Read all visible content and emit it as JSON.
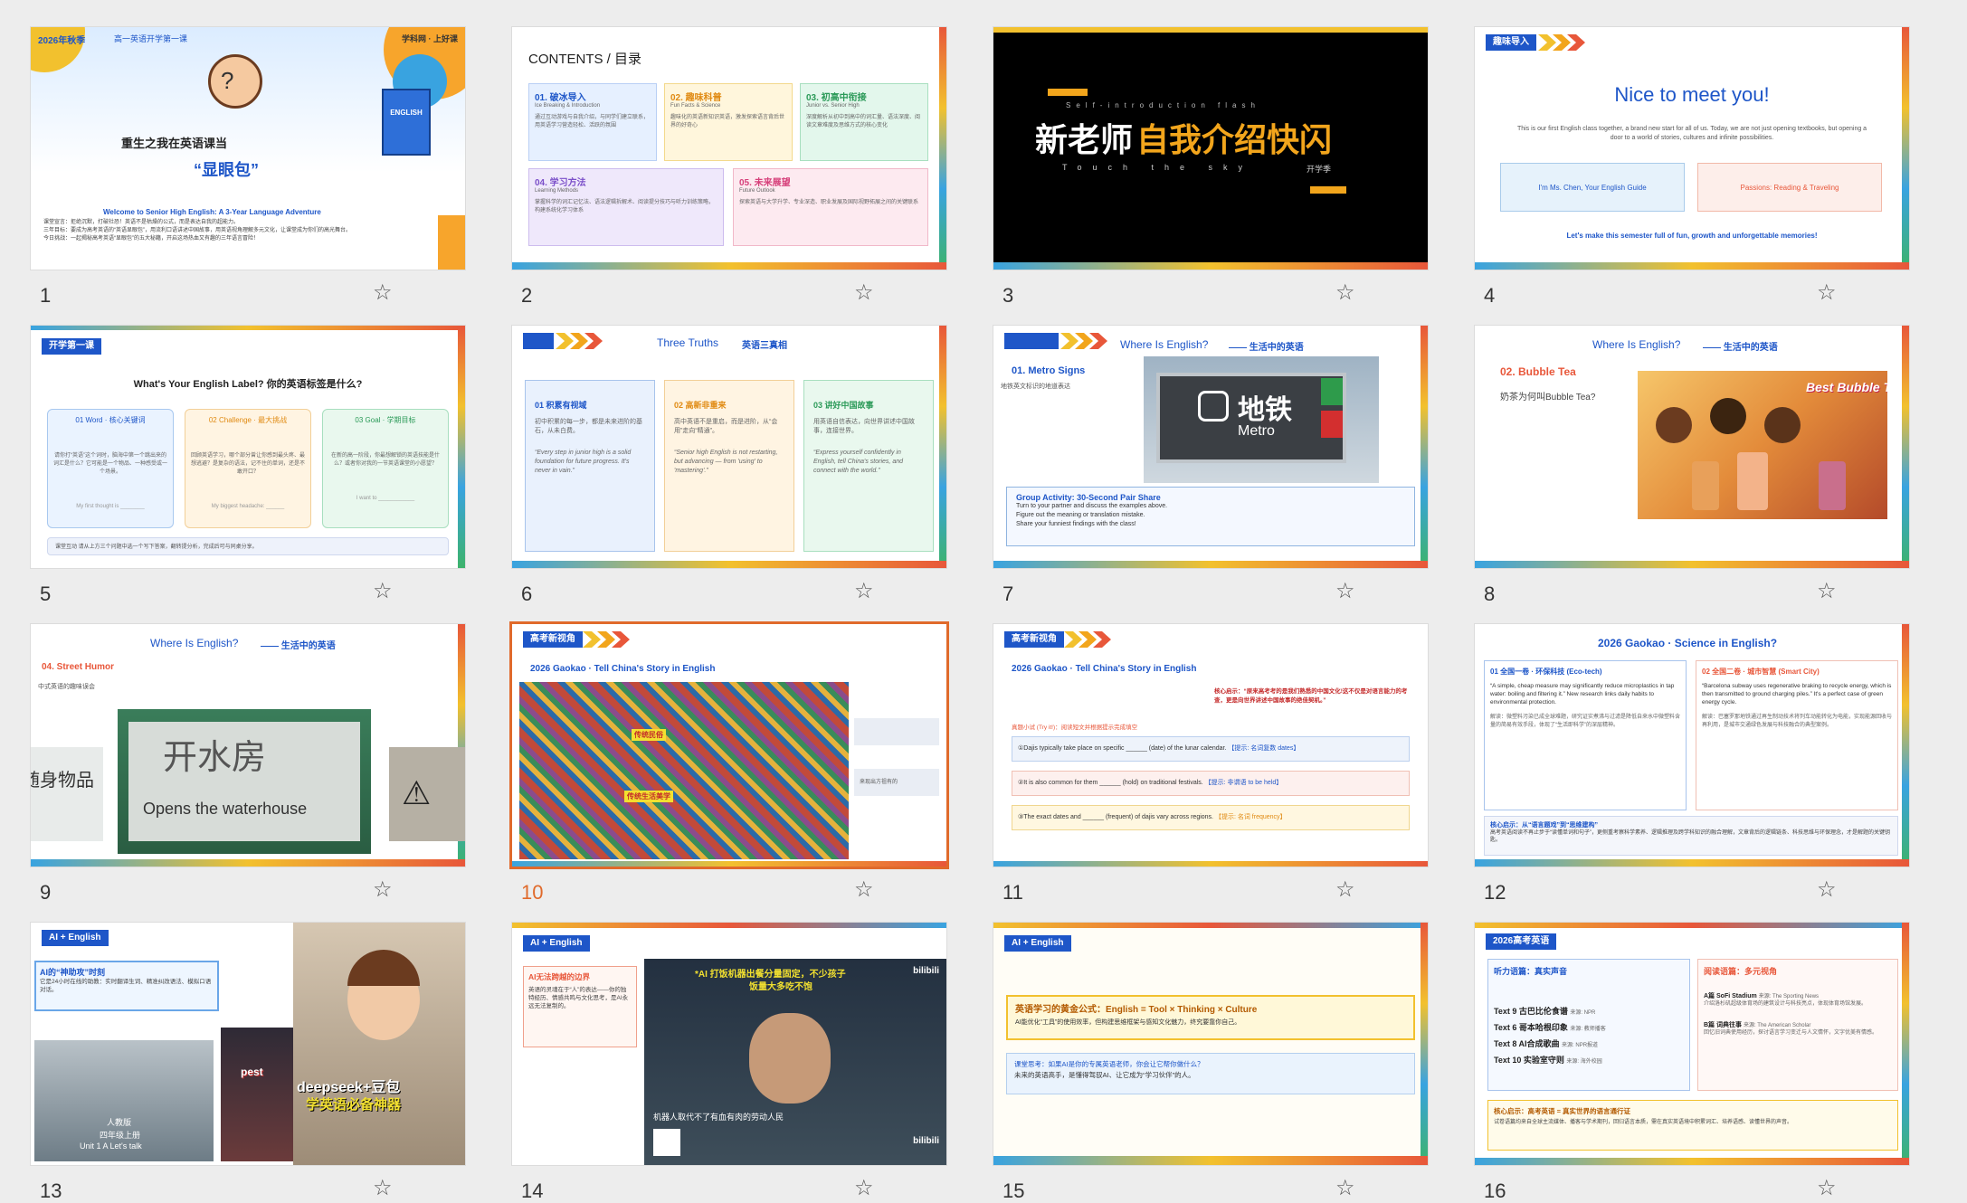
{
  "colors": {
    "accent": "#e06a2b",
    "blue": "#1e56c8",
    "yellow": "#f2c12e",
    "red": "#e8573a",
    "green": "#3db36b"
  },
  "slides": [
    {
      "num": "1",
      "tag": "2026年秋季",
      "subtag": "高一英语开学第一课",
      "brand": "学科网 · 上好课",
      "title_a": "重生之我在英语课当",
      "title_b": "“显眼包”",
      "book": "ENGLISH",
      "welcome": "Welcome to Senior High English: A 3-Year Language Adventure",
      "lines": [
        "课堂宣言：拒绝沉默，打破社恐！英语不是枯燥的公式，而是表达自我的超能力。",
        "三年目标：要成为高考英语的“英语显眼包”，用流利口语讲述中国故事，用英语视角理解多元文化，让课堂成为你们的高光舞台。",
        "今日挑战：一起揭秘高考英语“显眼包”的五大秘籍，开启这场热血又有趣的三年语言冒险！"
      ]
    },
    {
      "num": "2",
      "title": "CONTENTS / 目录",
      "cards": [
        {
          "h": "01. 破冰导入",
          "s": "Ice Breaking & Introduction",
          "d": "通过互动游戏与自我介绍，与同学们建立联系，用英语学习营造轻松、活跃的氛围"
        },
        {
          "h": "02. 趣味科普",
          "s": "Fun Facts & Science",
          "d": "趣味化的英语新知识英语，激发探索语言背后世界的好奇心"
        },
        {
          "h": "03. 初高中衔接",
          "s": "Junior vs. Senior High",
          "d": "深度解析从初中到高中的词汇量、语法深度、阅读文章难度及思维方式的核心变化"
        },
        {
          "h": "04. 学习方法",
          "s": "Learning Methods",
          "d": "掌握科学的词汇记忆法、语法逻辑拆解术、阅读提分技巧与听力训练策略，构建系统化学习体系"
        },
        {
          "h": "05. 未来展望",
          "s": "Future Outlook",
          "d": "探索英语与大学升学、专业深造、职业发展及国际视野拓展之间的关键联系"
        }
      ]
    },
    {
      "num": "3",
      "top": "Self-introduction flash",
      "main_a": "新老师",
      "main_b": "自我介绍快闪",
      "sub": "Touch the sky",
      "sub2": "开学季"
    },
    {
      "num": "4",
      "tag": "趣味导入",
      "title": "Nice to meet you!",
      "body": "This is our first English class together, a brand new start for all of us. Today, we are not just opening textbooks, but opening a door to a world of stories, cultures and infinite possibilities.",
      "btn1": "I'm Ms. Chen, Your English Guide",
      "btn2": "Passions: Reading & Traveling",
      "foot": "Let's make this semester full of fun, growth and unforgettable memories!"
    },
    {
      "num": "5",
      "tag": "开学第一课",
      "title": "What's Your English Label? 你的英语标签是什么?",
      "cards": [
        {
          "h": "01 Word · 核心关键词",
          "d": "请你打“英语”这个词时，脑海中第一个跳出来的词汇是什么？它可能是一个物品、一种感受或一个场景。",
          "f": "My first thought is ________"
        },
        {
          "h": "02 Challenge · 最大挑战",
          "d": "回顾英语学习，哪个部分曾让你感到最头疼、最想逃避？是复杂的语法，记不住的单词，还是不敢开口？",
          "f": "My biggest headache: ______"
        },
        {
          "h": "03 Goal · 学期目标",
          "d": "在新的高一阶段，你最想解锁的英语技能是什么？或者你对我的一节英语课堂的小愿望？",
          "f": "I want to ____________"
        }
      ],
      "foot": "课堂互动 请从上方三个问题中选一个写下答案，翻转提分析，完成后可与同桌分享。"
    },
    {
      "num": "6",
      "title": "Three Truths",
      "title_cn": "英语三真相",
      "cols": [
        {
          "h": "01 积累有视域",
          "d": "初中积累的每一步，都是未来进阶的基石，从未白费。",
          "q": "“Every step in junior high is a solid foundation for future progress. It's never in vain.”"
        },
        {
          "h": "02 高新非重来",
          "d": "高中英语不是重启，而是进阶，从“会用”走向“精通”。",
          "q": "“Senior high English is not restarting, but advancing — from 'using' to 'mastering'.”"
        },
        {
          "h": "03 讲好中国故事",
          "d": "用英语自信表达，向世界讲述中国故事，连接世界。",
          "q": "“Express yourself confidently in English, tell China's stories, and connect with the world.”"
        }
      ]
    },
    {
      "num": "7",
      "title": "Where Is English?",
      "title_cn": "—— 生活中的英语",
      "sec": "01. Metro Signs",
      "sub": "地铁英文标识的地道表达",
      "sign_cn": "地铁",
      "sign_en": "Metro",
      "act": "Group Activity: 30-Second Pair Share",
      "acts": [
        "Turn to your partner and discuss the examples above.",
        "Figure out the meaning or translation mistake.",
        "Share your funniest findings with the class!"
      ]
    },
    {
      "num": "8",
      "title": "Where Is English?",
      "title_cn": "—— 生活中的英语",
      "sec": "02. Bubble Tea",
      "sub": "奶茶为何叫Bubble Tea?",
      "badge": "Best Bubble Tea"
    },
    {
      "num": "9",
      "title": "Where Is English?",
      "title_cn": "—— 生活中的英语",
      "sec": "04. Street Humor",
      "sub": "中式英语的趣味误会",
      "sign_cn": "开水房",
      "sign_en": "Opens the waterhouse",
      "side": "随身物品"
    },
    {
      "num": "10",
      "tag": "高考新视角",
      "title": "2026 Gaokao · Tell China's Story in English",
      "l1": "传统民俗",
      "l2": "传统生活美学",
      "side": "来现出方祖有的"
    },
    {
      "num": "11",
      "tag": "高考新视角",
      "title": "2026 Gaokao · Tell China's Story in English",
      "core": "核心启示：“原来高考考的是我们熟悉的中国文化!这不仅是对语言能力的考查，更是向世界讲述中国故事的绝佳契机。”",
      "task": "真题小试 (Try it!)：阅读短文并根据提示完成填空",
      "items": [
        {
          "t": "①Dajis typically take place on specific ______ (date) of the lunar calendar.",
          "h": "【提示: 名词复数 dates】"
        },
        {
          "t": "②It is also common for them ______ (hold) on traditional festivals.",
          "h": "【提示: 非谓语 to be held】"
        },
        {
          "t": "③The exact dates and ______ (frequent) of dajis vary across regions.",
          "h": "【提示: 名词 frequency】"
        }
      ]
    },
    {
      "num": "12",
      "title": "2026 Gaokao · Science in English?",
      "c1h": "01 全国一卷 · 环保科技 (Eco-tech)",
      "c1": "“A simple, cheap measure may significantly reduce microplastics in tap water: boiling and filtering it.” New research links daily habits to environmental protection.",
      "c1cn": "解读：微塑料污染已成全球难题，研究证实煮沸与过滤是降低自来水中微塑料含量的简易有效手段，体现了“生活即科学”的深层精神。",
      "c2h": "02 全国二卷 · 城市智慧 (Smart City)",
      "c2": "“Barcelona subway uses regenerative braking to recycle energy, which is then transmitted to ground charging piles.” It's a perfect case of green energy cycle.",
      "c2cn": "解读：巴塞罗那地铁通过再生制动技术将列车动能转化为电能，实现能源回收与再利用，是城市交通绿色发展与科技融合的典型案例。",
      "core": "核心启示：从“语言题戏”到“思维建构”",
      "corebody": "高考英语阅读不再止步于“读懂单词和句子”，更侧重考察科学素养、逻辑推理及跨学科知识的融合理解，文章背后的逻辑链条、科技思维与环保理念，才是解题的关键钥匙。"
    },
    {
      "num": "13",
      "tag": "AI + English",
      "box_h": "AI的“神助攻”时刻",
      "box": "它是24小时在线的助教：实时翻译生词、精准纠改语法、模拟口语对话。",
      "cap1": "人教版",
      "cap2": "四年级上册",
      "cap3": "Unit 1 A Let's talk",
      "pest": "pest",
      "banner": "deepseek+豆包",
      "banner2": "学英语必备神器"
    },
    {
      "num": "14",
      "tag": "AI + English",
      "box_h": "AI无法跨越的边界",
      "box": "英语的灵魂在于“人”的表达——你的独特经历、情感共鸣与文化思考，是AI永远无法复制的。",
      "cap_top": "*AI 打饭机器出餐分量固定，不少孩子",
      "cap_top2": "饭量大多吃不饱",
      "cap_bot": "机器人取代不了有血有肉的劳动人民",
      "logo": "bilibili"
    },
    {
      "num": "15",
      "tag": "AI + English",
      "formula": "英语学习的黄金公式：English = Tool × Thinking × Culture",
      "formula2": "AI能优化“工具”的使用效率，但构建思维框架与感知文化魅力，终究要靠你自己。",
      "think": "课堂思考：如果AI是你的专属英语老师，你会让它帮你做什么？",
      "think2": "未来的英语高手，是懂得驾驭AI、让它成为“学习伙伴”的人。"
    },
    {
      "num": "16",
      "tag": "2026高考英语",
      "c1h": "听力语篇：真实声音",
      "items": [
        {
          "t": "Text 9 古巴比伦食谱",
          "s": "来源: NPR"
        },
        {
          "t": "Text 6 哥本哈根印象",
          "s": "来源: 教师播客"
        },
        {
          "t": "Text 8 AI合成歌曲",
          "s": "来源: NPR报道"
        },
        {
          "t": "Text 10 实验室守则",
          "s": "来源: 海外校园"
        }
      ],
      "c2h": "阅读语篇：多元视角",
      "r1": "A篇 SoFi Stadium",
      "r1s": "来源: The Sporting News",
      "r1d": "介绍洛杉矶超级体育场的建筑设计与科技亮点，体现体育场馆发展。",
      "r2": "B篇 词典往事",
      "r2s": "来源: The American Scholar",
      "r2d": "回忆旧词典使用经历，探讨语言学习变迁与人文情怀，文字优美有情感。",
      "core": "核心启示：高考英语 = 真实世界的语言通行证",
      "corebody": "试卷语篇均来自全球主流媒体、播客与学术期刊，回归语言本质，需在真实英语境中积累词汇、培养语感、读懂世界的声音。"
    }
  ]
}
